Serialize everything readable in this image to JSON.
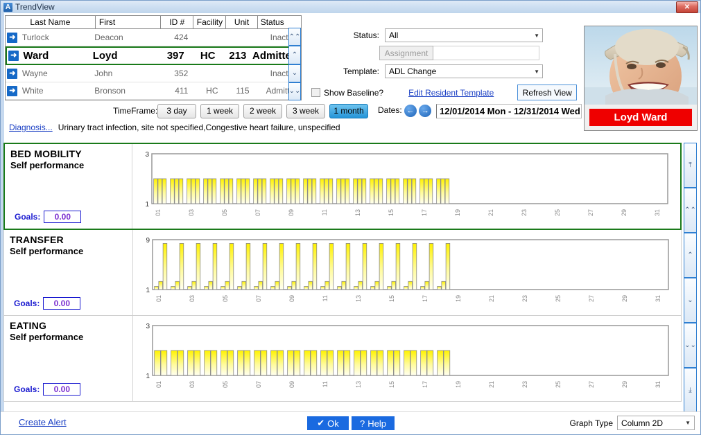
{
  "window": {
    "title": "TrendView",
    "icon": "app-icon",
    "close_label": "✕"
  },
  "resident_table": {
    "columns": [
      "Last Name",
      "First",
      "ID #",
      "Facility",
      "Unit",
      "Status"
    ],
    "rows": [
      {
        "last": "Turlock",
        "first": "Deacon",
        "id": "424",
        "facility": "",
        "unit": "",
        "status": "Inactive",
        "selected": false
      },
      {
        "last": "Ward",
        "first": "Loyd",
        "id": "397",
        "facility": "HC",
        "unit": "213",
        "status": "Admitted",
        "selected": true
      },
      {
        "last": "Wayne",
        "first": "John",
        "id": "352",
        "facility": "",
        "unit": "",
        "status": "Inactive",
        "selected": false
      },
      {
        "last": "White",
        "first": "Bronson",
        "id": "411",
        "facility": "HC",
        "unit": "115",
        "status": "Admitted",
        "selected": false
      }
    ],
    "scroll": [
      "⌃⌃",
      "⌃",
      "⌄",
      "⌄⌄"
    ]
  },
  "filters": {
    "status_label": "Status:",
    "status_value": "All",
    "assignment_button": "Assignment",
    "assignment_value": "",
    "template_label": "Template:",
    "template_value": "ADL Change",
    "show_baseline_label": "Show Baseline?",
    "show_baseline_checked": false,
    "edit_template_link": "Edit Resident Template",
    "refresh_button": "Refresh View"
  },
  "resident_photo": {
    "name_badge": "Loyd Ward",
    "badge_color": "#ef0000"
  },
  "timeframe": {
    "label": "TimeFrame:",
    "buttons": [
      {
        "label": "3 day",
        "active": false
      },
      {
        "label": "1 week",
        "active": false
      },
      {
        "label": "2 week",
        "active": false
      },
      {
        "label": "3 week",
        "active": false
      },
      {
        "label": "1 month",
        "active": true
      }
    ],
    "dates_label": "Dates:",
    "prev_icon": "arrow-left-icon",
    "next_icon": "arrow-right-icon",
    "date_range": "12/01/2014 Mon - 12/31/2014 Wed"
  },
  "diagnosis": {
    "link": "Diagnosis...",
    "text": "Urinary tract infection, site not specified,Congestive heart failure, unspecified"
  },
  "goals_label": "Goals:",
  "chart_data": [
    {
      "type": "bar",
      "title": "BED MOBILITY",
      "subtitle": "Self performance",
      "goals_value": "0.00",
      "selected": true,
      "ylim": [
        1,
        3
      ],
      "yticks": [
        1,
        3
      ],
      "xlabel": "",
      "ylabel": "",
      "grid": false,
      "legend": "none",
      "bar_color": "#FFF200",
      "categories": [
        "01",
        "02",
        "03",
        "04",
        "05",
        "06",
        "07",
        "08",
        "09",
        "10",
        "11",
        "12",
        "13",
        "14",
        "15",
        "16",
        "17",
        "18",
        "19",
        "20",
        "21",
        "22",
        "23",
        "24",
        "25",
        "26",
        "27",
        "28",
        "29",
        "30",
        "31"
      ],
      "xtick_labels": [
        "01",
        "03",
        "05",
        "07",
        "09",
        "11",
        "13",
        "15",
        "17",
        "19",
        "21",
        "23",
        "25",
        "27",
        "29",
        "31"
      ],
      "series": [
        {
          "name": "series1",
          "values": [
            2,
            2,
            2,
            2,
            2,
            2,
            2,
            2,
            2,
            2,
            2,
            2,
            2,
            2,
            2,
            2,
            2,
            2,
            null,
            null,
            null,
            null,
            null,
            null,
            null,
            null,
            null,
            null,
            null,
            null,
            null
          ]
        },
        {
          "name": "series2",
          "values": [
            2,
            2,
            2,
            2,
            2,
            2,
            2,
            2,
            2,
            2,
            2,
            2,
            2,
            2,
            2,
            2,
            2,
            2,
            null,
            null,
            null,
            null,
            null,
            null,
            null,
            null,
            null,
            null,
            null,
            null,
            null
          ]
        },
        {
          "name": "series3",
          "values": [
            2,
            2,
            2,
            2,
            2,
            2,
            2,
            2,
            2,
            2,
            2,
            2,
            2,
            2,
            2,
            2,
            2,
            2,
            null,
            null,
            null,
            null,
            null,
            null,
            null,
            null,
            null,
            null,
            null,
            null,
            null
          ]
        }
      ]
    },
    {
      "type": "bar",
      "title": "TRANSFER",
      "subtitle": "Self performance",
      "goals_value": "0.00",
      "selected": false,
      "ylim": [
        1,
        9
      ],
      "yticks": [
        1,
        9
      ],
      "xlabel": "",
      "ylabel": "",
      "grid": false,
      "legend": "none",
      "bar_color": "#FFF200",
      "categories": [
        "01",
        "02",
        "03",
        "04",
        "05",
        "06",
        "07",
        "08",
        "09",
        "10",
        "11",
        "12",
        "13",
        "14",
        "15",
        "16",
        "17",
        "18",
        "19",
        "20",
        "21",
        "22",
        "23",
        "24",
        "25",
        "26",
        "27",
        "28",
        "29",
        "30",
        "31"
      ],
      "xtick_labels": [
        "01",
        "03",
        "05",
        "07",
        "09",
        "11",
        "13",
        "15",
        "17",
        "19",
        "21",
        "23",
        "25",
        "27",
        "29",
        "31"
      ],
      "series": [
        {
          "name": "series1",
          "values": [
            1.5,
            1.5,
            1.5,
            1.5,
            1.5,
            1.5,
            1.5,
            1.5,
            1.5,
            1.5,
            1.5,
            1.5,
            1.5,
            1.5,
            1.5,
            1.5,
            1.5,
            1.5,
            null,
            null,
            null,
            null,
            null,
            null,
            null,
            null,
            null,
            null,
            null,
            null,
            null
          ]
        },
        {
          "name": "series2",
          "values": [
            2.3,
            2.3,
            2.3,
            2.3,
            2.3,
            2.3,
            2.3,
            2.3,
            2.3,
            2.3,
            2.3,
            2.3,
            2.3,
            2.3,
            2.3,
            2.3,
            2.3,
            2.3,
            null,
            null,
            null,
            null,
            null,
            null,
            null,
            null,
            null,
            null,
            null,
            null,
            null
          ]
        },
        {
          "name": "series3",
          "values": [
            8.4,
            8.4,
            8.4,
            8.4,
            8.4,
            8.4,
            8.4,
            8.4,
            8.4,
            8.4,
            8.4,
            8.4,
            8.4,
            8.4,
            8.4,
            8.4,
            8.4,
            8.4,
            null,
            null,
            null,
            null,
            null,
            null,
            null,
            null,
            null,
            null,
            null,
            null,
            null
          ]
        }
      ]
    },
    {
      "type": "bar",
      "title": "EATING",
      "subtitle": "Self performance",
      "goals_value": "0.00",
      "selected": false,
      "ylim": [
        1,
        3
      ],
      "yticks": [
        1,
        3
      ],
      "xlabel": "",
      "ylabel": "",
      "grid": false,
      "legend": "none",
      "bar_color": "#FFF200",
      "categories": [
        "01",
        "02",
        "03",
        "04",
        "05",
        "06",
        "07",
        "08",
        "09",
        "10",
        "11",
        "12",
        "13",
        "14",
        "15",
        "16",
        "17",
        "18",
        "19",
        "20",
        "21",
        "22",
        "23",
        "24",
        "25",
        "26",
        "27",
        "28",
        "29",
        "30",
        "31"
      ],
      "xtick_labels": [
        "01",
        "03",
        "05",
        "07",
        "09",
        "11",
        "13",
        "15",
        "17",
        "19",
        "21",
        "23",
        "25",
        "27",
        "29",
        "31"
      ],
      "series": [
        {
          "name": "series1",
          "values": [
            2,
            2,
            2,
            2,
            2,
            2,
            2,
            2,
            2,
            2,
            2,
            2,
            2,
            2,
            2,
            2,
            2,
            2,
            null,
            null,
            null,
            null,
            null,
            null,
            null,
            null,
            null,
            null,
            null,
            null,
            null
          ]
        },
        {
          "name": "series2",
          "values": [
            2,
            2,
            2,
            2,
            2,
            2,
            2,
            2,
            2,
            2,
            2,
            2,
            2,
            2,
            2,
            2,
            2,
            2,
            null,
            null,
            null,
            null,
            null,
            null,
            null,
            null,
            null,
            null,
            null,
            null,
            null
          ]
        }
      ]
    }
  ],
  "right_scroll": [
    "⤒",
    "⌃⌃",
    "⌃",
    "⌄",
    "⌄⌄",
    "⤓"
  ],
  "footer": {
    "create_alert": "Create Alert",
    "ok_button": "Ok",
    "ok_icon": "check-icon",
    "help_button": "Help",
    "help_icon": "question-icon",
    "graph_type_label": "Graph Type",
    "graph_type_value": "Column 2D"
  }
}
